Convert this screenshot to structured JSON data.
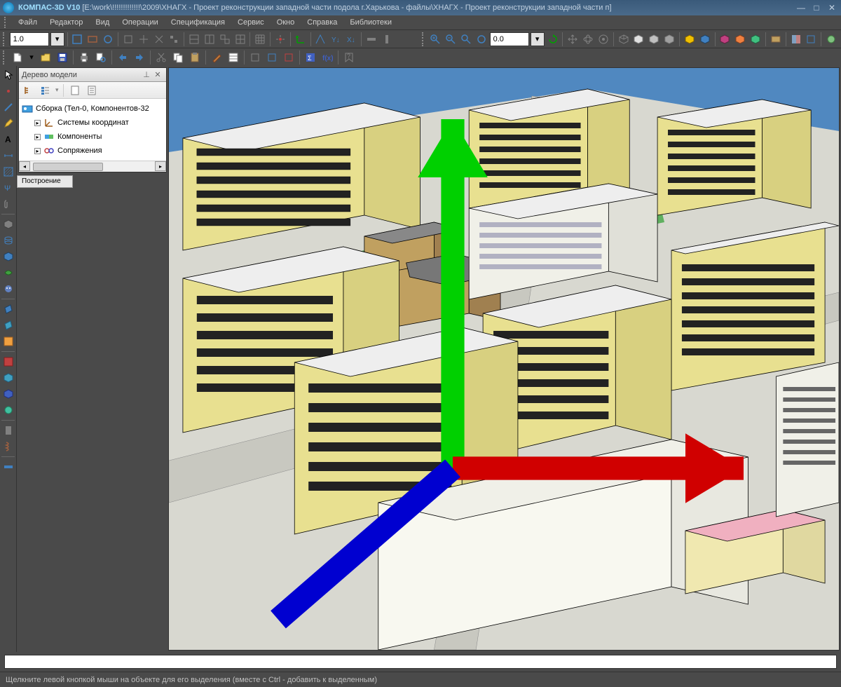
{
  "app": {
    "name": "КОМПАС-3D V10",
    "document_path": "[E:\\work\\!!!!!!!!!!!!!\\2009\\ХНАГХ - Проект реконструкции западной части подола г.Харькова - файлы\\ХНАГХ - Проект реконструкции западной части п]"
  },
  "menu": {
    "items": [
      "Файл",
      "Редактор",
      "Вид",
      "Операции",
      "Спецификация",
      "Сервис",
      "Окно",
      "Справка",
      "Библиотеки"
    ]
  },
  "toolbar1": {
    "scale_value": "1.0",
    "coord_value": "0.0"
  },
  "tree": {
    "title": "Дерево модели",
    "root": "Сборка (Тел-0, Компонентов-32",
    "nodes": [
      "Системы координат",
      "Компоненты",
      "Сопряжения"
    ]
  },
  "tree_status": "Построение",
  "statusbar": {
    "hint": "Щелкните левой кнопкой мыши на объекте для его выделения (вместе с Ctrl - добавить к выделенным)"
  },
  "icons": {
    "minimize": "—",
    "maximize": "□",
    "close": "✕",
    "pin": "⊥",
    "triangle_down": "▾",
    "triangle_right": "▸",
    "plus": "+"
  }
}
